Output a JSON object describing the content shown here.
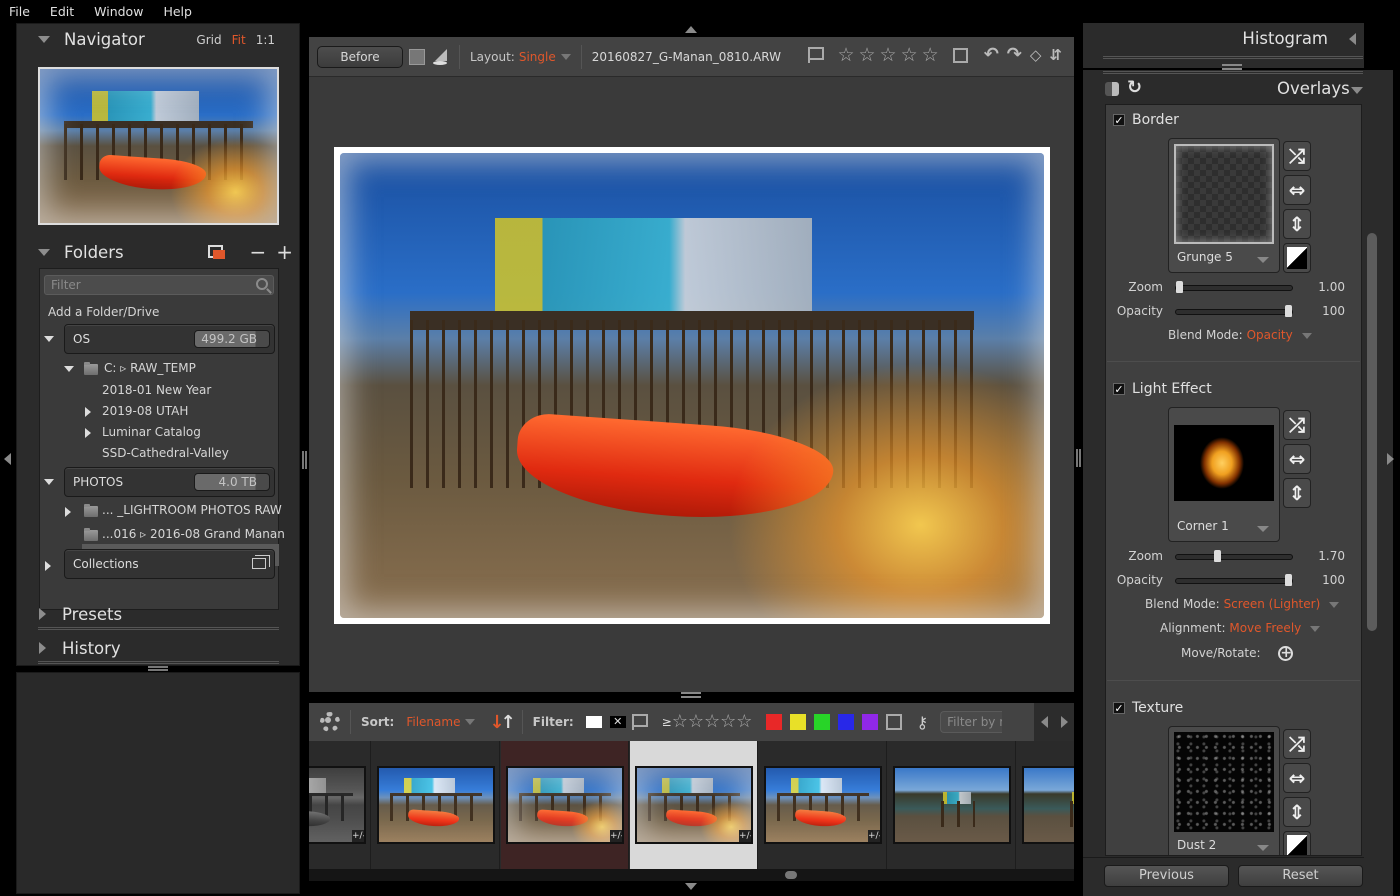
{
  "menu": [
    "File",
    "Edit",
    "Window",
    "Help"
  ],
  "left": {
    "navigator": {
      "title": "Navigator",
      "modes": [
        "Grid",
        "Fit",
        "1:1"
      ],
      "active_mode": "Fit"
    },
    "folders": {
      "title": "Folders",
      "filter_placeholder": "Filter",
      "add_label": "Add a Folder/Drive",
      "drives": [
        {
          "name": "OS",
          "capacity": "499.2 GB"
        },
        {
          "name": "PHOTOS",
          "capacity": "4.0 TB"
        }
      ],
      "os_tree": {
        "root": "C: ▹ RAW_TEMP",
        "children": [
          "2018-01 New Year",
          "2019-08 UTAH",
          "Luminar Catalog",
          "SSD-Cathedral-Valley"
        ]
      },
      "photos_tree": [
        "... _LIGHTROOM PHOTOS RAW",
        "...016 ▹ 2016-08 Grand Manan"
      ],
      "collections": "Collections"
    },
    "presets": "Presets",
    "history": "History"
  },
  "toolbar": {
    "before_label": "Before",
    "layout_label": "Layout:",
    "layout_value": "Single",
    "filename": "20160827_G-Manan_0810.ARW",
    "stars": [
      "☆",
      "☆",
      "☆",
      "☆",
      "☆"
    ],
    "rotate_left": "↶",
    "rotate_right": "↷"
  },
  "filmbar": {
    "sort_label": "Sort:",
    "sort_value": "Filename",
    "filter_label": "Filter:",
    "gte": "≥",
    "stars": [
      "☆",
      "☆",
      "☆",
      "☆",
      "☆"
    ],
    "colors": [
      "#e82828",
      "#e8e028",
      "#28d428",
      "#2828e8",
      "#9028e8"
    ],
    "filter_placeholder": "Filter by m",
    "key_icon": "⚷",
    "x_mark": "✕"
  },
  "filmstrip": {
    "thumbs": [
      {
        "style": "bw",
        "edited": true
      },
      {
        "style": "plain",
        "edited": false
      },
      {
        "style": "grunge",
        "edited": true
      },
      {
        "style": "grunge",
        "edited": true
      },
      {
        "style": "plain",
        "edited": true
      },
      {
        "style": "harbor",
        "edited": false
      },
      {
        "style": "harbor",
        "edited": false
      }
    ],
    "selected_index": 3,
    "highlighted_index": 2,
    "edit_badge": "+/-"
  },
  "right": {
    "histogram": "Histogram",
    "overlays": "Overlays",
    "sections": [
      {
        "title": "Border",
        "enabled": true,
        "texture": "Grunge  5",
        "zoom": "1.00",
        "zoom_fraction": 0.0,
        "opacity": "100",
        "opacity_fraction": 1.0,
        "blend_label": "Blend Mode:",
        "blend_value": "Opacity"
      },
      {
        "title": "Light Effect",
        "enabled": true,
        "texture": "Corner  1",
        "zoom": "1.70",
        "zoom_fraction": 0.35,
        "opacity": "100",
        "opacity_fraction": 1.0,
        "blend_label": "Blend Mode:",
        "blend_value": "Screen (Lighter)",
        "align_label": "Alignment:",
        "align_value": "Move Freely",
        "move_label": "Move/Rotate:"
      },
      {
        "title": "Texture",
        "enabled": true,
        "texture": "Dust  2"
      }
    ],
    "labels": {
      "zoom": "Zoom",
      "opacity": "Opacity",
      "check": "✓"
    },
    "tool_glyphs": {
      "shuffle": "⤮",
      "flip_h": "⇔",
      "flip_v": "⇕"
    },
    "previous": "Previous",
    "reset": "Reset"
  }
}
